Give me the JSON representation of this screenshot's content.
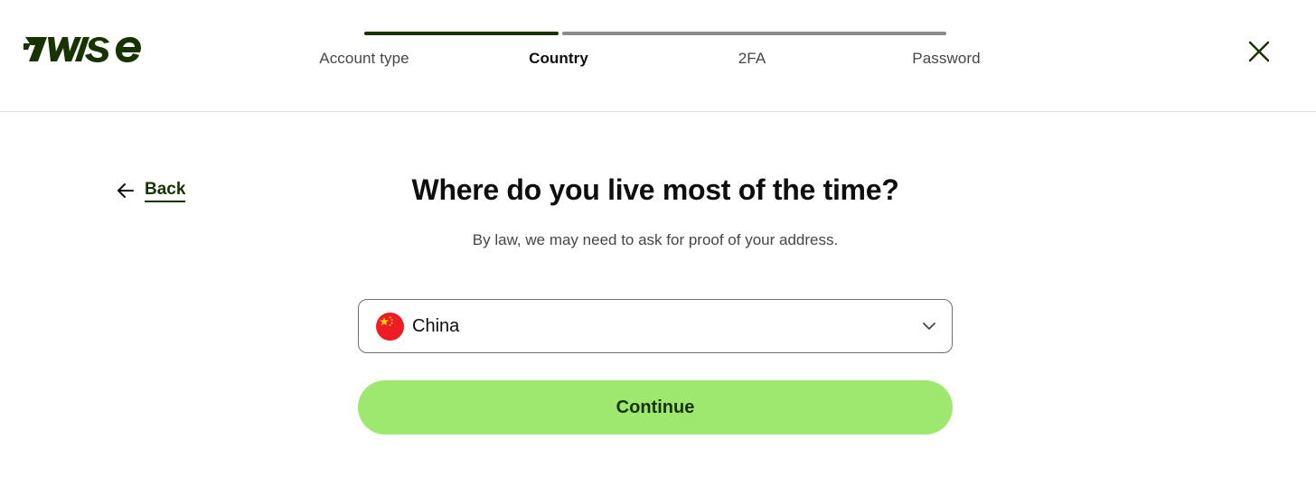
{
  "header": {
    "logo_text": "7WISE",
    "close_icon": "close-icon"
  },
  "stepper": {
    "steps": [
      {
        "label": "Account type",
        "state": "completed"
      },
      {
        "label": "Country",
        "state": "current"
      },
      {
        "label": "2FA",
        "state": "upcoming"
      },
      {
        "label": "Password",
        "state": "upcoming"
      }
    ],
    "progress_fraction": 0.33
  },
  "back": {
    "label": "Back",
    "icon": "arrow-left-icon"
  },
  "main": {
    "title": "Where do you live most of the time?",
    "subtitle": "By law, we may need to ask for proof of your address.",
    "country_select": {
      "value": "China",
      "flag_icon": "china-flag-icon",
      "chevron_icon": "chevron-down-icon"
    },
    "continue_label": "Continue"
  },
  "colors": {
    "brand_dark": "#163300",
    "brand_green": "#9fe870",
    "text": "#0e0f0c",
    "muted_text": "#454745"
  }
}
